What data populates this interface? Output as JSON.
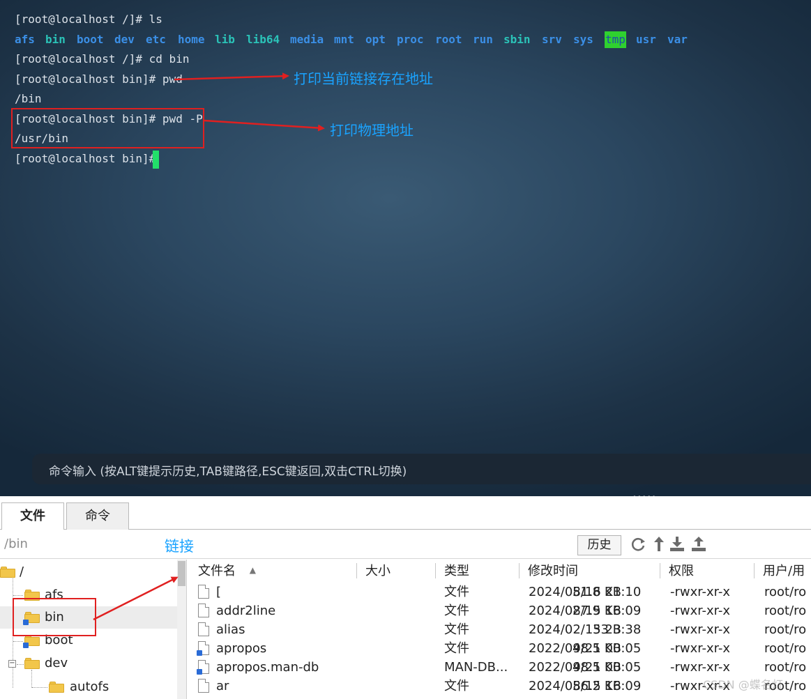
{
  "terminal": {
    "lines": {
      "l1": "[root@localhost /]# ls",
      "l3": "[root@localhost /]# cd bin",
      "l4": "[root@localhost bin]# pwd",
      "l5": "/bin",
      "l6": "[root@localhost bin]# pwd -P",
      "l7": "/usr/bin",
      "l8": "[root@localhost bin]# "
    },
    "ls_output": [
      "afs",
      "bin",
      "boot",
      "dev",
      "etc",
      "home",
      "lib",
      "lib64",
      "media",
      "mnt",
      "opt",
      "proc",
      "root",
      "run",
      "sbin",
      "srv",
      "sys",
      "tmp",
      "usr",
      "var"
    ],
    "annotations": {
      "logical": "打印当前链接存在地址",
      "physical": "打印物理地址"
    },
    "command_input_hint": "命令输入 (按ALT键提示历史,TAB键路径,ESC键返回,双击CTRL切换)",
    "grip": "•••••"
  },
  "tabs": {
    "file": "文件",
    "command": "命令"
  },
  "toolbar": {
    "path": "/bin",
    "link_annotation": "链接",
    "history_button": "历史",
    "icons": [
      "refresh-icon",
      "up-icon",
      "download-icon",
      "upload-icon"
    ]
  },
  "tree": {
    "root": "/",
    "items": [
      "afs",
      "bin",
      "boot",
      "dev",
      "autofs"
    ]
  },
  "table": {
    "headers": {
      "name": "文件名",
      "size": "大小",
      "type": "类型",
      "mtime": "修改时间",
      "perm": "权限",
      "owner": "用户/用"
    },
    "sort_indicator": "▲",
    "rows": [
      {
        "name": "[",
        "size": "51.8 KB",
        "type": "文件",
        "mtime": "2024/08/16 21:10",
        "perm": "-rwxr-xr-x",
        "owner": "root/ro"
      },
      {
        "name": "addr2line",
        "size": "27.9 KB",
        "type": "文件",
        "mtime": "2024/08/15 16:09",
        "perm": "-rwxr-xr-x",
        "owner": "root/ro"
      },
      {
        "name": "alias",
        "size": "33 B",
        "type": "文件",
        "mtime": "2024/02/15 23:38",
        "perm": "-rwxr-xr-x",
        "owner": "root/ro"
      },
      {
        "name": "apropos",
        "size": "48.5 KB",
        "type": "文件",
        "mtime": "2022/09/21 00:05",
        "perm": "-rwxr-xr-x",
        "owner": "root/ro"
      },
      {
        "name": "apropos.man-db",
        "size": "48.5 KB",
        "type": "MAN-DB...",
        "mtime": "2022/09/21 00:05",
        "perm": "-rwxr-xr-x",
        "owner": "root/ro"
      },
      {
        "name": "ar",
        "size": "56.2 KB",
        "type": "文件",
        "mtime": "2024/08/15 16:09",
        "perm": "-rwxr-xr-x",
        "owner": "root/ro"
      }
    ]
  },
  "watermark": "CSDN @蝶名灯",
  "colors": {
    "annotation_blue": "#1aa3ff",
    "highlight_red": "#e02020",
    "cursor_green": "#22e06a",
    "dir_blue": "#3b8fe6",
    "dir_cyan": "#2bc3b8",
    "tmp_bg": "#2fd12f"
  }
}
